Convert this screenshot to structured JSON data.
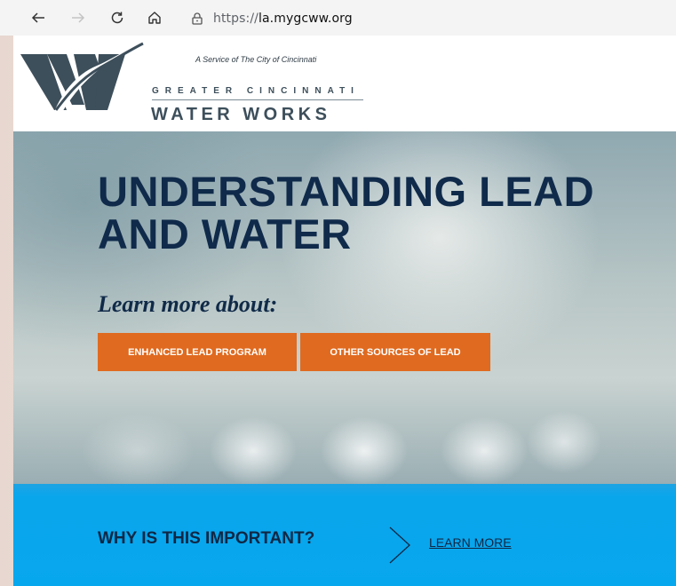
{
  "browser": {
    "url_protocol": "https://",
    "url_host": "la.mygcww.org"
  },
  "header": {
    "tagline": "A Service of The City of Cincinnati",
    "brand_top": "GREATER CINCINNATI",
    "brand_bottom": "WATER WORKS"
  },
  "hero": {
    "title_line1": "UNDERSTANDING LEAD",
    "title_line2": "AND WATER",
    "subtitle": "Learn more about:",
    "button_1": "ENHANCED LEAD PROGRAM",
    "button_2": "OTHER SOURCES OF LEAD"
  },
  "band": {
    "question": "WHY IS THIS IMPORTANT?",
    "link": "LEARN MORE"
  },
  "colors": {
    "accent_orange": "#e06a1f",
    "band_blue": "#07a7ee",
    "navy": "#0f2a4a",
    "logo_slate": "#3d4f5b"
  },
  "icons": {
    "back": "back-arrow-icon",
    "forward": "forward-arrow-icon",
    "reload": "reload-icon",
    "home": "home-icon",
    "lock": "lock-icon",
    "chevron": "chevron-right-icon",
    "logo": "gcww-w-logo-icon"
  }
}
